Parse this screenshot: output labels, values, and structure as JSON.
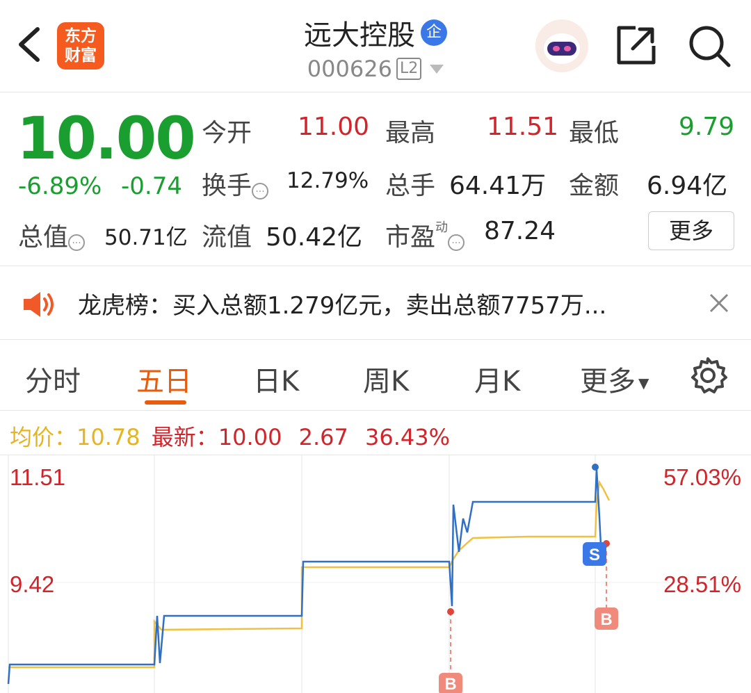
{
  "header": {
    "logo_line1": "东方",
    "logo_line2": "财富",
    "stock_name": "远大控股",
    "badge": "企",
    "stock_code": "000626",
    "level_badge": "L2"
  },
  "quote": {
    "price": "10.00",
    "change_pct": "-6.89%",
    "change_abs": "-0.74",
    "open_label": "今开",
    "open_value": "11.00",
    "high_label": "最高",
    "high_value": "11.51",
    "low_label": "最低",
    "low_value": "9.79",
    "turnover_label": "换手",
    "turnover_value": "12.79%",
    "volume_label": "总手",
    "volume_value": "64.41万",
    "amount_label": "金额",
    "amount_value": "6.94亿",
    "total_cap_label": "总值",
    "total_cap_value": "50.71亿",
    "float_cap_label": "流值",
    "float_cap_value": "50.42亿",
    "pe_label": "市盈",
    "pe_sup": "动",
    "pe_value": "87.24",
    "more_label": "更多",
    "info_glyph": "···"
  },
  "notice": {
    "text": "龙虎榜：买入总额1.279亿元，卖出总额7757万..."
  },
  "tabs": [
    "分时",
    "五日",
    "日K",
    "周K",
    "月K",
    "更多"
  ],
  "active_tab": "五日",
  "legend": {
    "avg_label": "均价：",
    "avg_value": "10.78",
    "latest_label": "最新：",
    "latest_value": "10.00",
    "latest_extra1": "2.67",
    "latest_extra2": "36.43%"
  },
  "chart_data": {
    "type": "line",
    "y_labels_left": [
      "11.51",
      "9.42"
    ],
    "y_labels_right": [
      "57.03%",
      "28.51%"
    ],
    "markers": [
      {
        "label": "S",
        "day": 5
      },
      {
        "label": "B",
        "day": 4
      },
      {
        "label": "B",
        "day": 5
      }
    ],
    "colors": {
      "price": "#2f6fc4",
      "avg": "#f0c040",
      "up": "#d0252b",
      "marker_s": "#3b78e7",
      "marker_b": "#f08a7a"
    }
  }
}
